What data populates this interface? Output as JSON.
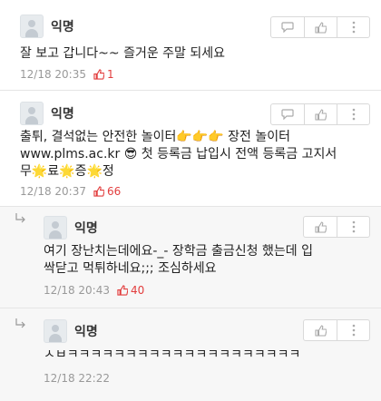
{
  "comments": [
    {
      "author": "익명",
      "text": "잘 보고 갑니다~~ 즐거운 주말 되세요",
      "time": "12/18 20:35",
      "likes": "1"
    },
    {
      "author": "익명",
      "line1": "출튀, 결석없는 안전한 놀이터👉👉👉 장전 놀이터",
      "line2": "www.plms.ac.kr 😎 첫 등록금 납입시 전액 등록금 고지서",
      "line3": "무🌟료🌟증🌟정",
      "time": "12/18 20:37",
      "likes": "66"
    },
    {
      "author": "익명",
      "line1": "여기 장난치는데에요-_- 장학금 출금신청 했는데 입",
      "line2": "싹닫고 먹튀하네요;;; 조심하세요",
      "time": "12/18 20:43",
      "likes": "40"
    },
    {
      "author": "익명",
      "text": "ㅅㅂㅋㅋㅋㅋㅋㅋㅋㅋㅋㅋㅋㅋㅋㅋㅋㅋㅋㅋㅋㅋ",
      "time": "12/18 22:22"
    }
  ],
  "icons": {
    "reply": "speech-bubble-icon",
    "like": "thumbs-up-icon",
    "more": "more-icon",
    "reply_indicator": "reply-arrow-icon"
  },
  "colors": {
    "like_count": "#e23d3d",
    "meta": "#999999",
    "reply_bg": "#f7f7f7"
  }
}
